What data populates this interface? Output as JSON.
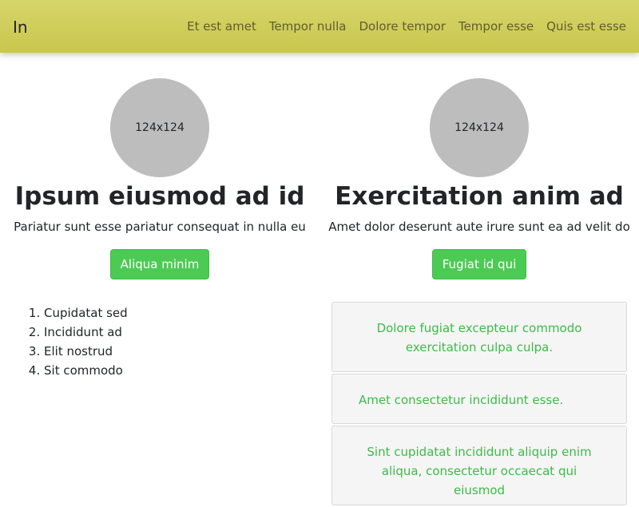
{
  "navbar": {
    "brand": "In",
    "links": [
      "Et est amet",
      "Tempor nulla",
      "Dolore tempor",
      "Tempor esse",
      "Quis est esse"
    ]
  },
  "columns": [
    {
      "avatar_text": "124x124",
      "heading": "Ipsum eiusmod ad id",
      "lead": "Pariatur sunt esse pariatur consequat in nulla eu",
      "button_label": "Aliqua minim"
    },
    {
      "avatar_text": "124x124",
      "heading": "Exercitation anim ad",
      "lead": "Amet dolor deserunt aute irure sunt ea ad velit do",
      "button_label": "Fugiat id qui"
    }
  ],
  "list_items": [
    "Cupidatat sed",
    "Incididunt ad",
    "Elit nostrud",
    "Sit commodo"
  ],
  "cards": [
    "Dolore fugiat excepteur commodo exercitation culpa culpa.",
    "Amet consectetur incididunt esse.",
    "Sint cupidatat incididunt aliquip enim aliqua, consectetur occaecat qui eiusmod"
  ],
  "colors": {
    "navbar_bg": "#d0cf5d",
    "button_bg": "#4ccb54",
    "card_text": "#3dbb47",
    "avatar_bg": "#bdbdbd"
  }
}
